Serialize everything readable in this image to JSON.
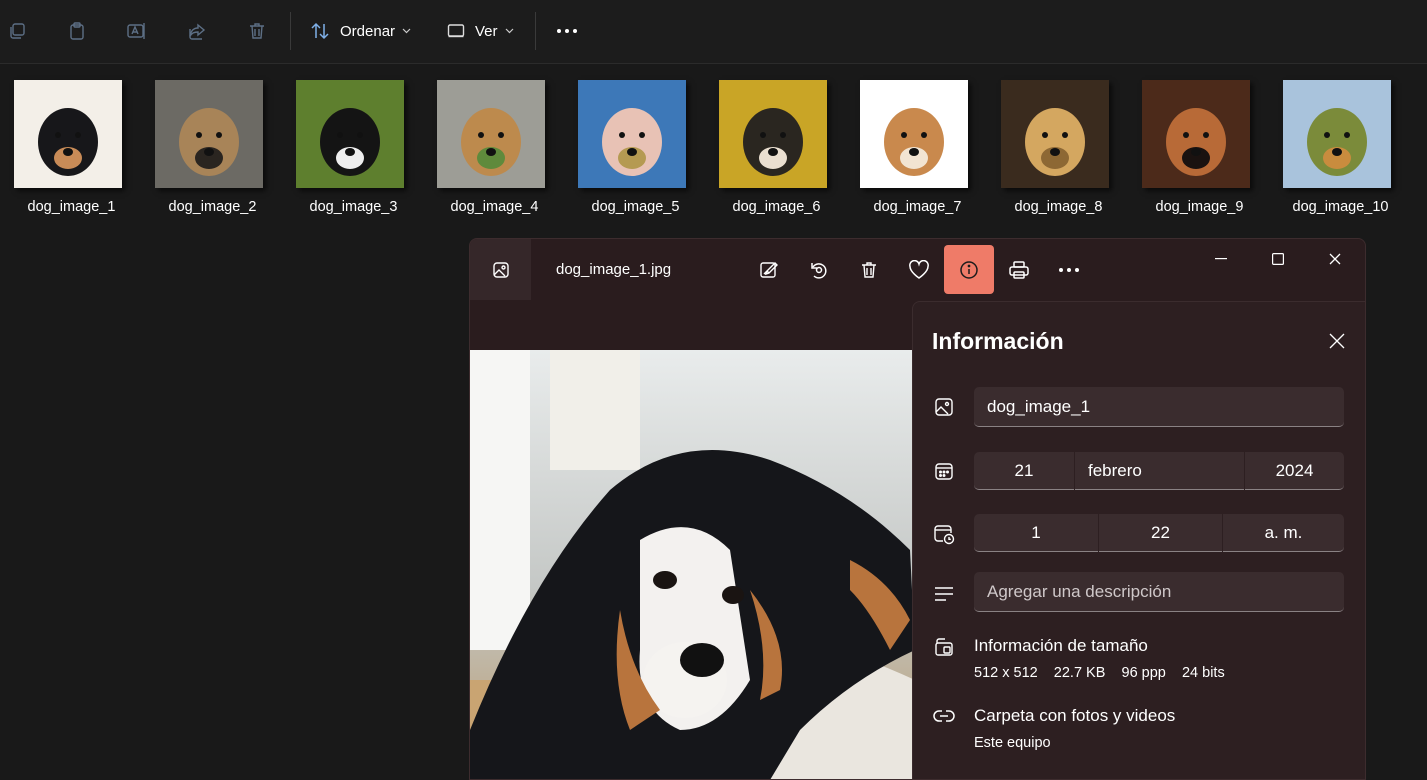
{
  "toolbar": {
    "icons": [
      "copy-icon",
      "paste-icon",
      "rename-icon",
      "share-icon",
      "delete-icon"
    ],
    "sort_label": "Ordenar",
    "view_label": "Ver",
    "more_label": "..."
  },
  "files": [
    {
      "name": "dog_image_1",
      "colors": [
        "#f3efe8",
        "#17171a",
        "#c88b57"
      ]
    },
    {
      "name": "dog_image_2",
      "colors": [
        "#6c6a64",
        "#a88458",
        "#2a2520"
      ]
    },
    {
      "name": "dog_image_3",
      "colors": [
        "#5e7f2e",
        "#141414",
        "#eeeeee"
      ]
    },
    {
      "name": "dog_image_4",
      "colors": [
        "#9d9d96",
        "#bd8a4d",
        "#5f8a3c"
      ]
    },
    {
      "name": "dog_image_5",
      "colors": [
        "#3d78b8",
        "#e8c2b5",
        "#b59a52"
      ]
    },
    {
      "name": "dog_image_6",
      "colors": [
        "#c9a526",
        "#2a2620",
        "#eadfd0"
      ]
    },
    {
      "name": "dog_image_7",
      "colors": [
        "#ffffff",
        "#c9894d",
        "#f2e4d2"
      ]
    },
    {
      "name": "dog_image_8",
      "colors": [
        "#3a2b1e",
        "#d4a760",
        "#8d6834"
      ]
    },
    {
      "name": "dog_image_9",
      "colors": [
        "#4c2a1a",
        "#b86a37",
        "#1a1210"
      ]
    },
    {
      "name": "dog_image_10",
      "colors": [
        "#a9c3dc",
        "#7b8b3a",
        "#c98c3e"
      ]
    }
  ],
  "viewer": {
    "filename": "dog_image_1.jpg",
    "tools": [
      "edit-icon",
      "rotate-icon",
      "delete-icon",
      "favorite-icon",
      "info-icon",
      "print-icon",
      "more-icon"
    ]
  },
  "info_panel": {
    "title": "Información",
    "file_name": "dog_image_1",
    "date": {
      "day": "21",
      "month": "febrero",
      "year": "2024"
    },
    "time": {
      "hour": "1",
      "minute": "22",
      "period": "a. m."
    },
    "description_placeholder": "Agregar una descripción",
    "size_header": "Información de tamaño",
    "size_details": "512 x 512    22.7 KB    96 ppp    24 bits",
    "folder_header": "Carpeta con fotos y videos",
    "folder_location": "Este equipo"
  },
  "colors": {
    "accent": "#ef7b68",
    "panel_bg": "#2d1f21",
    "field_bg": "#3a2c2e"
  }
}
